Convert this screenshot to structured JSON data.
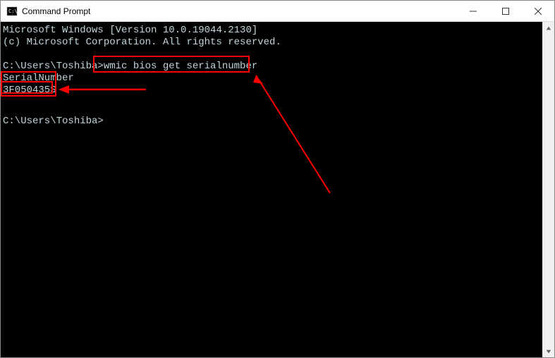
{
  "window": {
    "title": "Command Prompt"
  },
  "terminal": {
    "line1": "Microsoft Windows [Version 10.0.19044.2130]",
    "line2": "(c) Microsoft Corporation. All rights reserved.",
    "prompt1_path": "C:\\Users\\Toshiba>",
    "prompt1_cmd": "wmic bios get serialnumber",
    "output_header": "SerialNumber",
    "output_value": "3F050435S",
    "prompt2_path": "C:\\Users\\Toshiba>"
  },
  "annotations": {
    "highlight_color": "#ff0000"
  }
}
